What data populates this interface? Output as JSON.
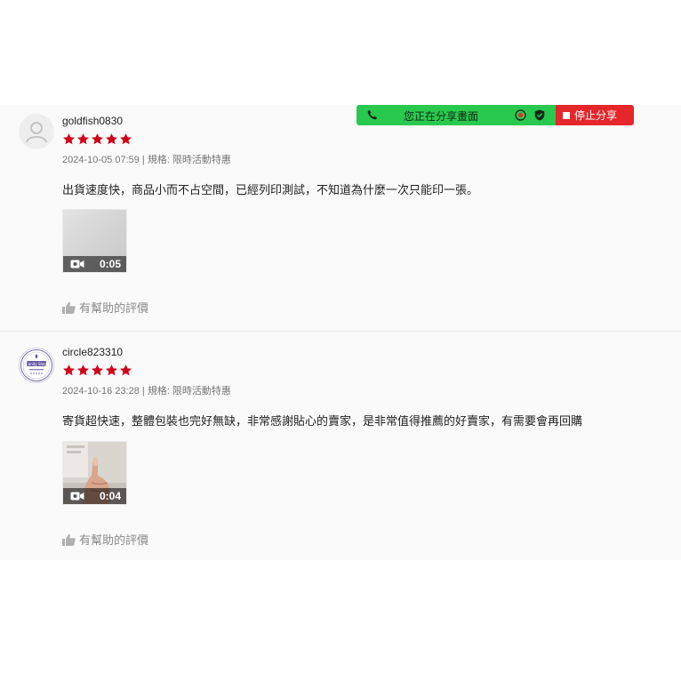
{
  "share_bar": {
    "status_text": "您正在分享畫面",
    "stop_label": "停止分享",
    "colors": {
      "active": "#29c84e",
      "stop": "#e5262a"
    }
  },
  "reviews": [
    {
      "username": "goldfish0830",
      "rating": 5,
      "meta": "2024-10-05 07:59 | 規格: 限時活動特惠",
      "comment": "出貨速度快，商品小而不占空間，已經列印測試，不知道為什麼一次只能印一張。",
      "video": {
        "duration": "0:05"
      },
      "helpful_label": "有幫助的評價",
      "avatar": "default-user-icon"
    },
    {
      "username": "circle823310",
      "rating": 5,
      "meta": "2024-10-16 23:28 | 規格: 限時活動特惠",
      "comment": "寄貨超快速，整體包裝也完好無缺，非常感謝貼心的賣家，是非常值得推薦的好賣家，有需要會再回購",
      "video": {
        "duration": "0:04"
      },
      "helpful_label": "有幫助的評價",
      "avatar": "shop-logo",
      "avatar_text": "Candy Shop"
    }
  ],
  "colors": {
    "star": "#d0011b",
    "meta_text": "#757575",
    "helpful_text": "#8a8a8a"
  }
}
